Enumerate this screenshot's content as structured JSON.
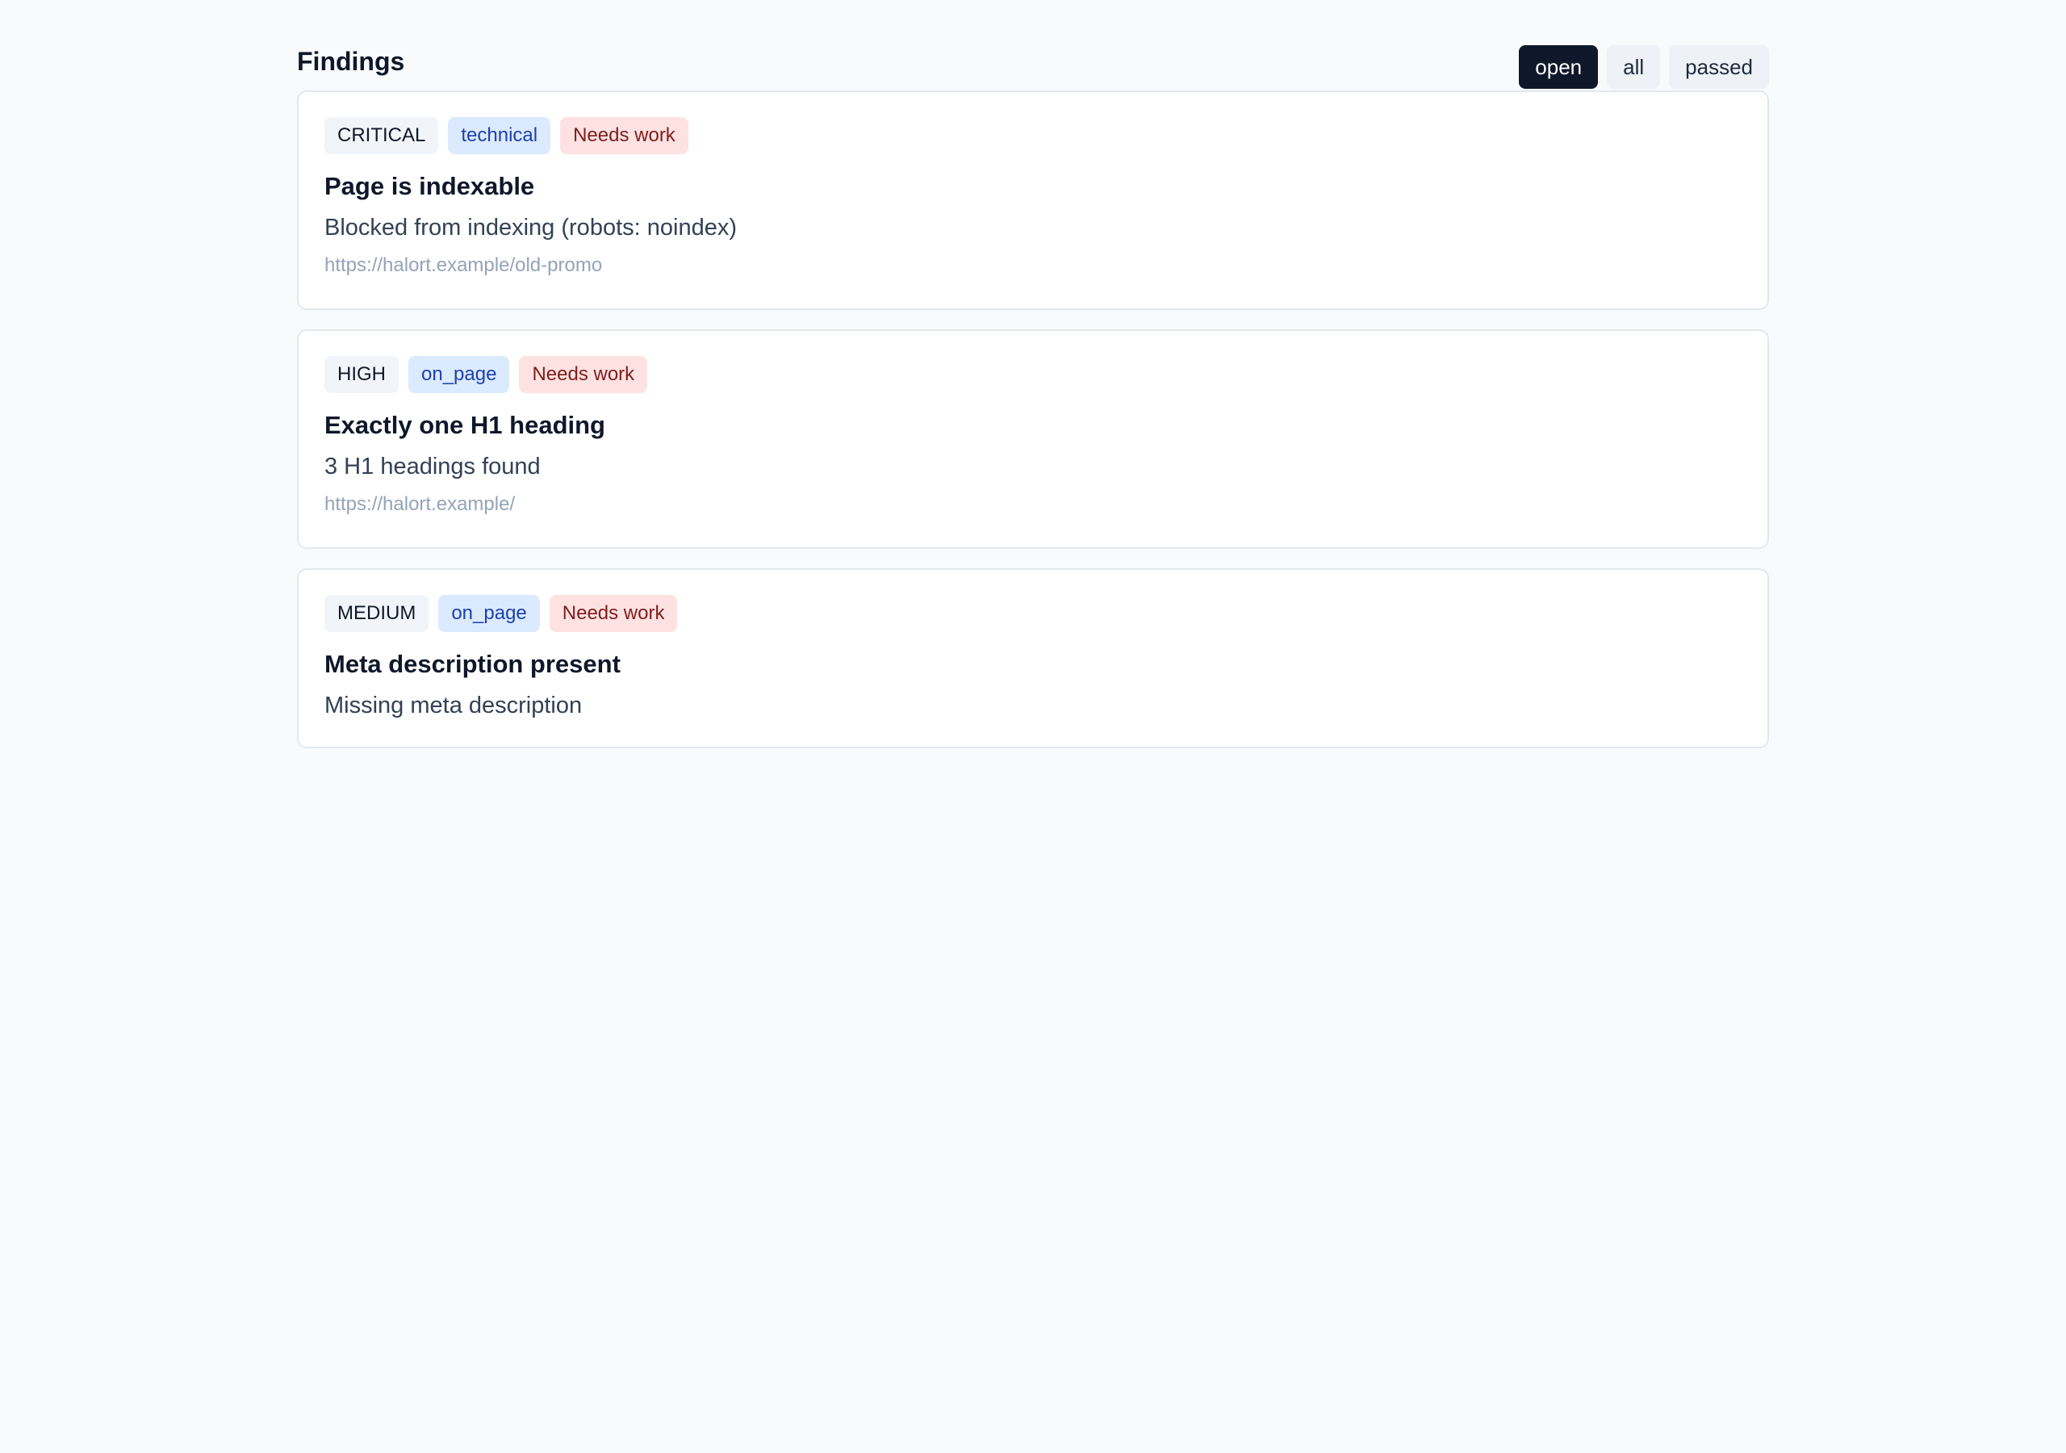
{
  "header": {
    "title": "Findings",
    "filters": [
      {
        "label": "open",
        "active": true
      },
      {
        "label": "all",
        "active": false
      },
      {
        "label": "passed",
        "active": false
      }
    ]
  },
  "findings": [
    {
      "severity": "CRITICAL",
      "category": "technical",
      "status": "Needs work",
      "title": "Page is indexable",
      "description": "Blocked from indexing (robots: noindex)",
      "url": "https://halort.example/old-promo"
    },
    {
      "severity": "HIGH",
      "category": "on_page",
      "status": "Needs work",
      "title": "Exactly one H1 heading",
      "description": "3 H1 headings found",
      "url": "https://halort.example/"
    },
    {
      "severity": "MEDIUM",
      "category": "on_page",
      "status": "Needs work",
      "title": "Meta description present",
      "description": "Missing meta description"
    }
  ],
  "colors": {
    "page_background": "#f8fafc",
    "active_filter": "#0f172a",
    "category_badge": "#dbeafe",
    "status_badge": "#fee2e2"
  }
}
